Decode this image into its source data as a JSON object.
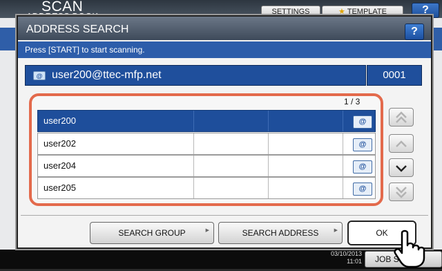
{
  "background": {
    "title": "SCAN",
    "subtitle": "ADDRESS BOOK",
    "settings_label": "SETTINGS",
    "template_label": "TEMPLATE",
    "help_label": "?",
    "date": "03/10/2013",
    "time": "11:01",
    "job_status_label": "JOB STATUS"
  },
  "dialog": {
    "title": "ADDRESS SEARCH",
    "help_label": "?",
    "message": "Press [START] to start scanning.",
    "address": "user200@ttec-mfp.net",
    "count": "0001",
    "page_indicator": "1  /  3",
    "rows": [
      {
        "name": "user200",
        "selected": true
      },
      {
        "name": "user202",
        "selected": false
      },
      {
        "name": "user204",
        "selected": false
      },
      {
        "name": "user205",
        "selected": false
      }
    ],
    "email_icon_glyph": "@",
    "search_group_label": "SEARCH GROUP",
    "search_address_label": "SEARCH ADDRESS",
    "ok_label": "OK"
  },
  "colors": {
    "accent": "#1e4e9b",
    "highlight_frame": "#e36a4c"
  },
  "icons": [
    "star-icon",
    "email-icon",
    "scroll-top-icon",
    "scroll-up-icon",
    "scroll-down-icon",
    "scroll-bottom-icon",
    "hand-pointer-icon"
  ]
}
